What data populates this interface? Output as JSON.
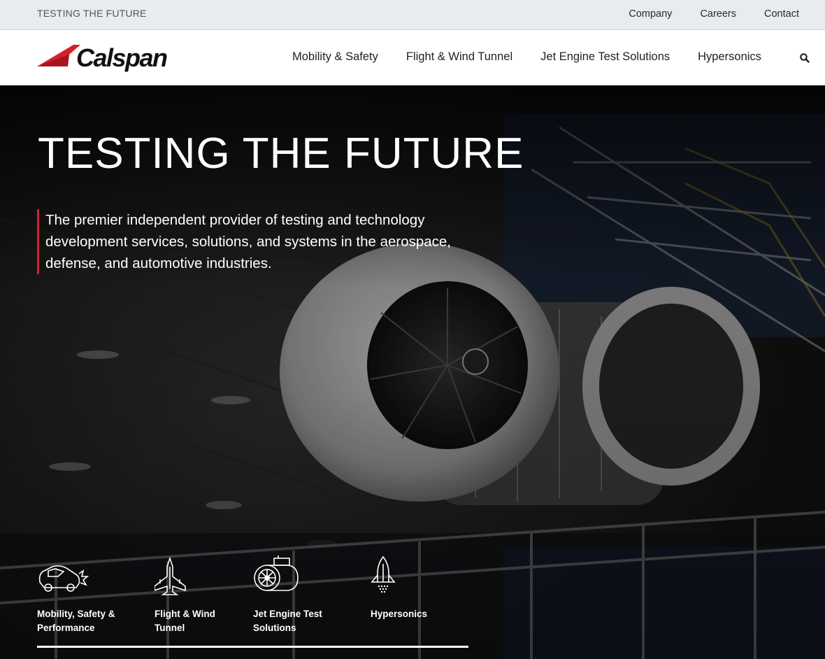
{
  "topbar": {
    "tagline": "TESTING THE FUTURE",
    "links": [
      "Company",
      "Careers",
      "Contact"
    ]
  },
  "header": {
    "brand": "Calspan",
    "nav": [
      "Mobility & Safety",
      "Flight & Wind Tunnel",
      "Jet Engine Test Solutions",
      "Hypersonics"
    ],
    "search_icon": "search-icon"
  },
  "hero": {
    "title": "TESTING THE FUTURE",
    "subtitle": "The premier independent provider of testing and technology development services, solutions, and systems in the aerospace, defense, and automotive industries.",
    "cards": [
      {
        "label": "Mobility, Safety & Performance",
        "icon": "car-crash-icon"
      },
      {
        "label": "Flight & Wind Tunnel",
        "icon": "jet-icon"
      },
      {
        "label": "Jet Engine Test Solutions",
        "icon": "jet-engine-icon"
      },
      {
        "label": "Hypersonics",
        "icon": "rocket-icon"
      }
    ]
  },
  "colors": {
    "accent_red": "#d6202b",
    "topbar_bg": "#e8ebef",
    "hero_text": "#ffffff"
  }
}
